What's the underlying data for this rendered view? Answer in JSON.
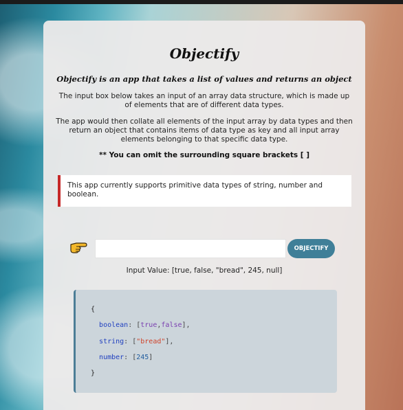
{
  "app": {
    "title": "Objectify",
    "subtitle": "Objectify is an app that takes a list of values and returns an object",
    "description_1": "The input box below takes an input of an array data structure, which is made up of elements that are of different data types.",
    "description_2": "The app would then collate all elements of the input array by data types and then return an object that contains items of data type as key and all input array elements belonging to that specific data type.",
    "note": "** You can omit the surrounding square brackets [ ]",
    "alert": "This app currently supports primitive data types of string, number and boolean."
  },
  "form": {
    "pointer_icon": "pointing-hand-icon",
    "input_value": "",
    "input_placeholder": "",
    "button_label": "OBJECTIFY",
    "input_value_display": "Input Value: [true, false, \"bread\", 245, null]"
  },
  "output": {
    "open_brace": "{",
    "close_brace": "}",
    "entries": [
      {
        "key": "boolean",
        "values": [
          "true",
          "false"
        ],
        "type": "boolean"
      },
      {
        "key": "string",
        "values": [
          "\"bread\""
        ],
        "type": "string"
      },
      {
        "key": "number",
        "values": [
          "245"
        ],
        "type": "number"
      }
    ]
  },
  "colors": {
    "button": "#3f7f98",
    "alert_border": "#c62828",
    "code_border": "#4b7d96",
    "code_background": "#ccd5db"
  }
}
